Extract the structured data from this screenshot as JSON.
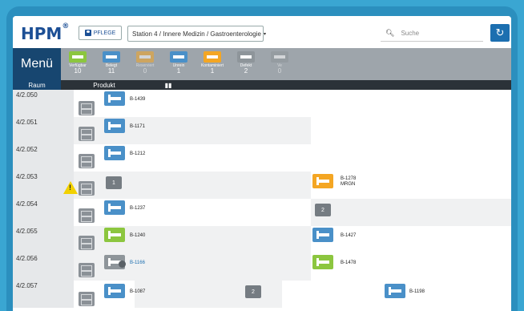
{
  "header": {
    "logo_text": "HPM",
    "logo_mark": "®",
    "role_button": "PFLEGE",
    "station_select": "Station 4 / Innere Medizin / Gastroenterologie",
    "search_placeholder": "Suche",
    "refresh_icon": "refresh-icon"
  },
  "menu": {
    "label": "Menü"
  },
  "filters": [
    {
      "label": "Verfügbar",
      "count": "10",
      "color": "#8cc63f"
    },
    {
      "label": "Belegt",
      "count": "11",
      "color": "#4a90c8"
    },
    {
      "label": "Reserviert",
      "count": "0",
      "color": "#f4a623"
    },
    {
      "label": "Unrein",
      "count": "1",
      "color": "#4a90c8"
    },
    {
      "label": "Kontaminiert",
      "count": "1",
      "color": "#f4a623"
    },
    {
      "label": "Defekt",
      "count": "2",
      "color": "#8e959a"
    },
    {
      "label": "Ve",
      "count": "0",
      "color": "#8e959a"
    }
  ],
  "tabs": {
    "raum": "Raum",
    "produkt": "Produkt",
    "map_icon": "map-icon"
  },
  "rows": [
    {
      "room": "4/2.050",
      "beds": [
        "B-1439"
      ]
    },
    {
      "room": "4/2.051",
      "beds": [
        "B-1171"
      ]
    },
    {
      "room": "4/2.052",
      "beds": [
        "B-1212"
      ]
    },
    {
      "room": "4/2.053",
      "count_a": "1",
      "bed_right": "B-1278",
      "bed_right_sub": "MRGN"
    },
    {
      "room": "4/2.054",
      "beds": [
        "B-1237"
      ],
      "count_b": "2"
    },
    {
      "room": "4/2.055",
      "beds": [
        "B-1240"
      ],
      "bed_right": "B-1427"
    },
    {
      "room": "4/2.056",
      "beds": [
        "B-1166"
      ],
      "bed_right": "B-1478"
    },
    {
      "room": "4/2.057",
      "beds": [
        "B-1087"
      ],
      "count_c": "2",
      "bed_far": "B-1198"
    }
  ]
}
